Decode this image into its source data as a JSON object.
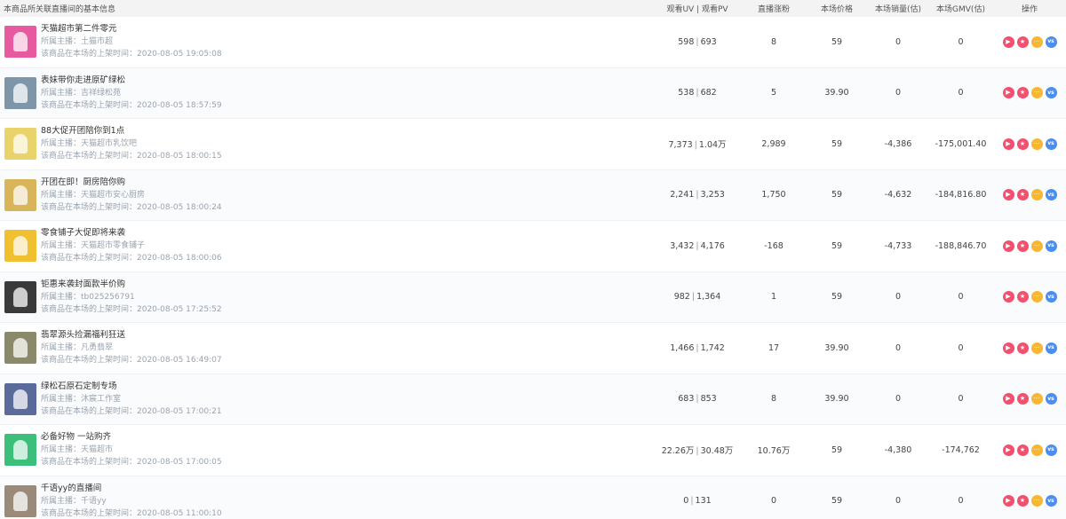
{
  "header": {
    "info": "本商品所关联直播间的基本信息",
    "uv_pv": "观看UV | 观看PV",
    "fans": "直播涨粉",
    "price": "本场价格",
    "sales": "本场销量(估)",
    "gmv": "本场GMV(估)",
    "ops": "操作"
  },
  "rows": [
    {
      "title": "天猫超市第二件零元",
      "anchor": "所属主播：土猫市超",
      "time": "该商品在本场的上架时间：2020-08-05 19:05:08",
      "uv": "598",
      "pv": "693",
      "fans": "8",
      "price": "59",
      "sales": "0",
      "gmv": "0",
      "thumb_color": "#e85aa0"
    },
    {
      "title": "表妹带你走进原矿绿松",
      "anchor": "所属主播：吉祥绿松苑",
      "time": "该商品在本场的上架时间：2020-08-05 18:57:59",
      "uv": "538",
      "pv": "682",
      "fans": "5",
      "price": "39.90",
      "sales": "0",
      "gmv": "0",
      "thumb_color": "#7f96a8"
    },
    {
      "title": "88大促开团陪你到1点",
      "anchor": "所属主播：天猫超市乳饮吧",
      "time": "该商品在本场的上架时间：2020-08-05 18:00:15",
      "uv": "7,373",
      "pv": "1.04万",
      "fans": "2,989",
      "price": "59",
      "sales": "-4,386",
      "gmv": "-175,001.40",
      "thumb_color": "#e9d36a"
    },
    {
      "title": "开团在即！厨房陪你购",
      "anchor": "所属主播：天猫超市安心厨房",
      "time": "该商品在本场的上架时间：2020-08-05 18:00:24",
      "uv": "2,241",
      "pv": "3,253",
      "fans": "1,750",
      "price": "59",
      "sales": "-4,632",
      "gmv": "-184,816.80",
      "thumb_color": "#d9b55a"
    },
    {
      "title": "零食铺子大促即将来袭",
      "anchor": "所属主播：天猫超市零食铺子",
      "time": "该商品在本场的上架时间：2020-08-05 18:00:06",
      "uv": "3,432",
      "pv": "4,176",
      "fans": "-168",
      "price": "59",
      "sales": "-4,733",
      "gmv": "-188,846.70",
      "thumb_color": "#f0c030"
    },
    {
      "title": "钜惠来袭封面款半价购",
      "anchor": "所属主播：tb025256791",
      "time": "该商品在本场的上架时间：2020-08-05 17:25:52",
      "uv": "982",
      "pv": "1,364",
      "fans": "1",
      "price": "59",
      "sales": "0",
      "gmv": "0",
      "thumb_color": "#3a3a3a"
    },
    {
      "title": "翡翠源头捡漏福利狂送",
      "anchor": "所属主播：凡勇翡翠",
      "time": "该商品在本场的上架时间：2020-08-05 16:49:07",
      "uv": "1,466",
      "pv": "1,742",
      "fans": "17",
      "price": "39.90",
      "sales": "0",
      "gmv": "0",
      "thumb_color": "#8a8a6a"
    },
    {
      "title": "绿松石原石定制专场",
      "anchor": "所属主播：沐宸工作室",
      "time": "该商品在本场的上架时间：2020-08-05 17:00:21",
      "uv": "683",
      "pv": "853",
      "fans": "8",
      "price": "39.90",
      "sales": "0",
      "gmv": "0",
      "thumb_color": "#5a6a9a"
    },
    {
      "title": "必备好物 一站购齐",
      "anchor": "所属主播：天猫超市",
      "time": "该商品在本场的上架时间：2020-08-05 17:00:05",
      "uv": "22.26万",
      "pv": "30.48万",
      "fans": "10.76万",
      "price": "59",
      "sales": "-4,380",
      "gmv": "-174,762",
      "thumb_color": "#3cbf7a"
    },
    {
      "title": "千语yy的直播间",
      "anchor": "所属主播：千语yy",
      "time": "该商品在本场的上架时间：2020-08-05 11:00:10",
      "uv": "0",
      "pv": "131",
      "fans": "0",
      "price": "59",
      "sales": "0",
      "gmv": "0",
      "thumb_color": "#9a8a7a"
    }
  ],
  "ops": {
    "play": "▶",
    "star": "★",
    "more": "···",
    "vs": "vs"
  },
  "colors": {
    "play": "#f2506e",
    "star": "#f2506e",
    "more": "#f7b733",
    "vs": "#4a8ef0"
  }
}
